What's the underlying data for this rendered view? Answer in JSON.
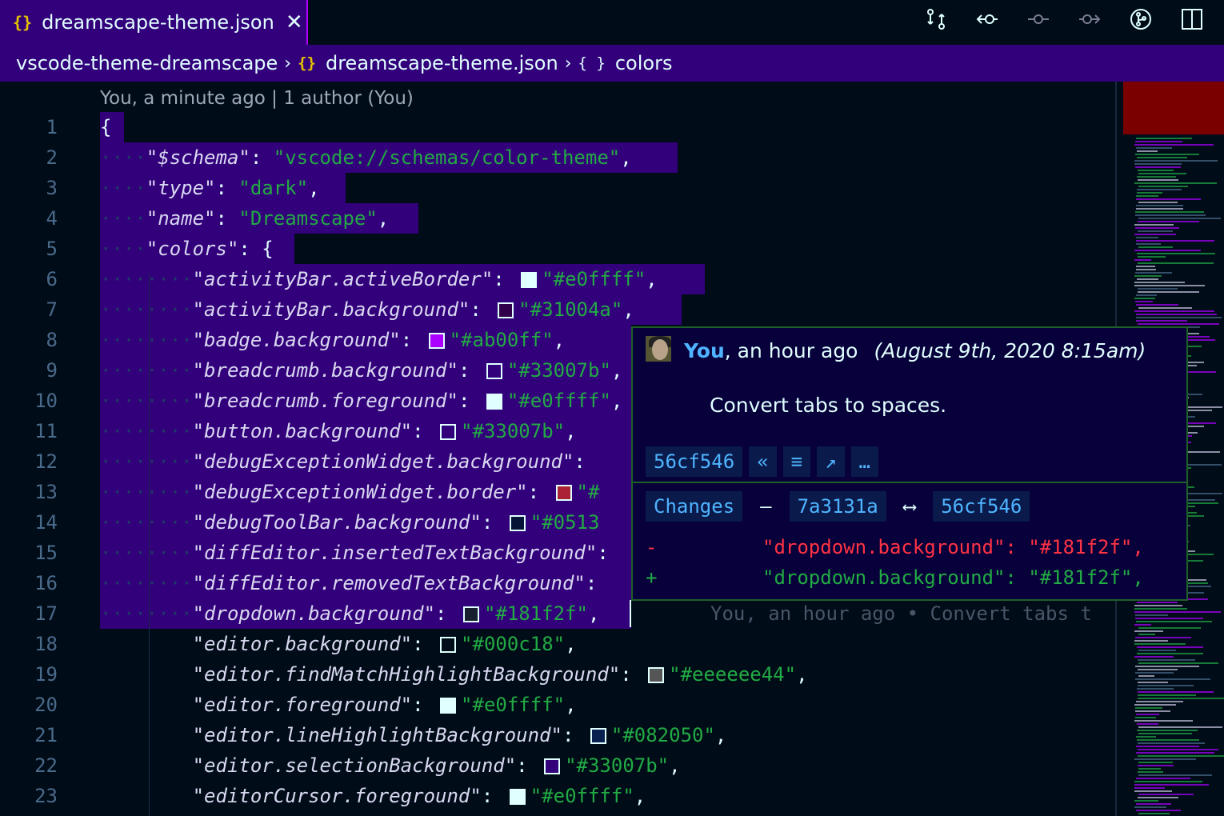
{
  "tab": {
    "label": "dreamscape-theme.json",
    "icon": "{}"
  },
  "toolbar": {
    "icons": [
      "source-control-compare-icon",
      "previous-change-icon",
      "blame-icon",
      "next-change-icon",
      "git-graph-icon",
      "split-editor-icon"
    ]
  },
  "breadcrumb": {
    "folder": "vscode-theme-dreamscape",
    "file": "dreamscape-theme.json",
    "symbol": "colors",
    "file_icon": "{}",
    "symbol_icon": "{ }"
  },
  "codelens": "You, a minute ago | 1 author (You)",
  "lines": [
    {
      "n": "1",
      "indent": 0,
      "text": "{"
    },
    {
      "n": "2",
      "indent": 1,
      "key": "\"$schema\"",
      "value": "\"vscode://schemas/color-theme\"",
      "tail": ","
    },
    {
      "n": "3",
      "indent": 1,
      "key": "\"type\"",
      "value": "\"dark\"",
      "tail": ","
    },
    {
      "n": "4",
      "indent": 1,
      "key": "\"name\"",
      "value": "\"Dreamscape\"",
      "tail": ","
    },
    {
      "n": "5",
      "indent": 1,
      "key": "\"colors\"",
      "value": "{",
      "tail": ""
    },
    {
      "n": "6",
      "indent": 2,
      "key": "\"activityBar.activeBorder\"",
      "swatch": "#e0ffff",
      "value": "\"#e0ffff\"",
      "tail": ","
    },
    {
      "n": "7",
      "indent": 2,
      "key": "\"activityBar.background\"",
      "swatch": "#31004a",
      "value": "\"#31004a\"",
      "tail": ","
    },
    {
      "n": "8",
      "indent": 2,
      "key": "\"badge.background\"",
      "swatch": "#ab00ff",
      "value": "\"#ab00ff\"",
      "tail": ","
    },
    {
      "n": "9",
      "indent": 2,
      "key": "\"breadcrumb.background\"",
      "swatch": "#33007b",
      "value": "\"#33007b\"",
      "tail": ","
    },
    {
      "n": "10",
      "indent": 2,
      "key": "\"breadcrumb.foreground\"",
      "swatch": "#e0ffff",
      "value": "\"#e0ffff\"",
      "tail": ","
    },
    {
      "n": "11",
      "indent": 2,
      "key": "\"button.background\"",
      "swatch": "#33007b",
      "value": "\"#33007b\"",
      "tail": ","
    },
    {
      "n": "12",
      "indent": 2,
      "key": "\"debugExceptionWidget.background\"",
      "value": "",
      "tail": ""
    },
    {
      "n": "13",
      "indent": 2,
      "key": "\"debugExceptionWidget.border\"",
      "swatch": "#aa2233",
      "value": "\"#",
      "tail": ""
    },
    {
      "n": "14",
      "indent": 2,
      "key": "\"debugToolBar.background\"",
      "swatch": "#051336",
      "value": "\"#0513",
      "tail": ""
    },
    {
      "n": "15",
      "indent": 2,
      "key": "\"diffEditor.insertedTextBackground\"",
      "value": "",
      "tail": ""
    },
    {
      "n": "16",
      "indent": 2,
      "key": "\"diffEditor.removedTextBackground\"",
      "value": "",
      "tail": ""
    },
    {
      "n": "17",
      "indent": 2,
      "key": "\"dropdown.background\"",
      "swatch": "#181f2f",
      "value": "\"#181f2f\"",
      "tail": ","
    },
    {
      "n": "18",
      "indent": 2,
      "key": "\"editor.background\"",
      "swatch": "#000c18",
      "value": "\"#000c18\"",
      "tail": ","
    },
    {
      "n": "19",
      "indent": 2,
      "key": "\"editor.findMatchHighlightBackground\"",
      "swatch": "#555555",
      "value": "\"#eeeeee44\"",
      "tail": ","
    },
    {
      "n": "20",
      "indent": 2,
      "key": "\"editor.foreground\"",
      "swatch": "#e0ffff",
      "value": "\"#e0ffff\"",
      "tail": ","
    },
    {
      "n": "21",
      "indent": 2,
      "key": "\"editor.lineHighlightBackground\"",
      "swatch": "#082050",
      "value": "\"#082050\"",
      "tail": ","
    },
    {
      "n": "22",
      "indent": 2,
      "key": "\"editor.selectionBackground\"",
      "swatch": "#33007b",
      "value": "\"#33007b\"",
      "tail": ","
    },
    {
      "n": "23",
      "indent": 2,
      "key": "\"editorCursor.foreground\"",
      "swatch": "#e0ffff",
      "value": "\"#e0ffff\"",
      "tail": ","
    }
  ],
  "inline_blame": "You, an hour ago • Convert tabs t",
  "hover": {
    "author": "You",
    "relative_time": ", an hour ago",
    "date": "(August 9th, 2020 8:15am)",
    "message": "Convert tabs to spaces.",
    "sha": "56cf546",
    "action_icons": [
      "«",
      "≡",
      "↗",
      "…"
    ],
    "changes_label": "Changes",
    "dash": "—",
    "from_sha": "7a3131a",
    "arrow": "⟷",
    "to_sha": "56cf546",
    "removed_sign": "-",
    "removed_line": "\"dropdown.background\": \"#181f2f\",",
    "added_sign": "+",
    "added_line": "\"dropdown.background\": \"#181f2f\","
  },
  "colors": {
    "accent": "#33007b",
    "tab_border": "#ab00ff",
    "editor_bg": "#000c18",
    "string": "#22aa44",
    "link": "#4fb4ff"
  }
}
